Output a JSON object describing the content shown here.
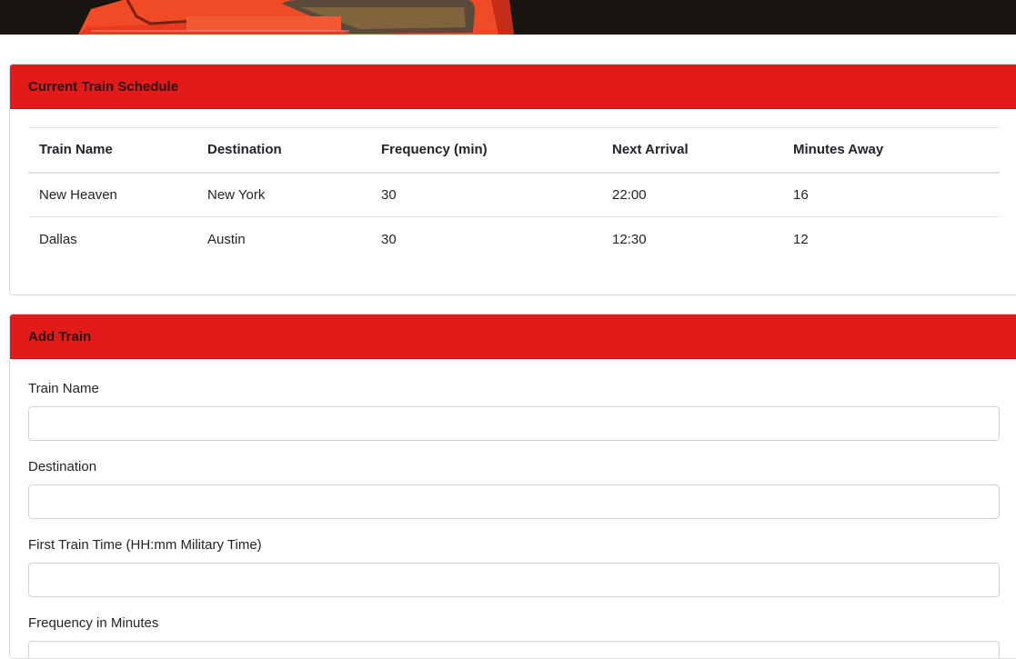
{
  "schedule": {
    "title": "Current Train Schedule",
    "columns": [
      "Train Name",
      "Destination",
      "Frequency (min)",
      "Next Arrival",
      "Minutes Away"
    ],
    "rows": [
      [
        "New Heaven",
        "New York",
        "30",
        "22:00",
        "16"
      ],
      [
        "Dallas",
        "Austin",
        "30",
        "12:30",
        "12"
      ]
    ]
  },
  "add_train": {
    "title": "Add Train",
    "fields": [
      {
        "label": "Train Name",
        "value": "",
        "placeholder": ""
      },
      {
        "label": "Destination",
        "value": "",
        "placeholder": ""
      },
      {
        "label": "First Train Time (HH:mm Military Time)",
        "value": "",
        "placeholder": ""
      },
      {
        "label": "Frequency in Minutes",
        "value": "",
        "placeholder": ""
      }
    ]
  },
  "colors": {
    "header_red": "#e21a1a",
    "hero_dark": "#14110e",
    "train_orange": "#f04a26"
  }
}
